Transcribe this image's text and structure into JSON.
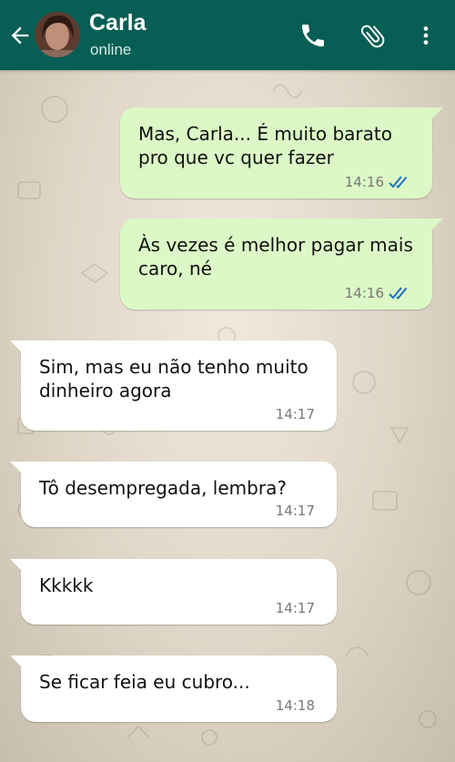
{
  "header": {
    "contact_name": "Carla",
    "status": "online",
    "color": "#075e54"
  },
  "icons": {
    "back": "arrow-left-icon",
    "phone": "phone-icon",
    "attach": "paperclip-icon",
    "menu": "more-vertical-icon",
    "read": "double-check-icon"
  },
  "messages": [
    {
      "direction": "out",
      "text": "Mas, Carla... É muito barato\npro que vc quer fazer",
      "time": "14:16",
      "read": true
    },
    {
      "direction": "out",
      "text": "Às vezes é melhor pagar mais\ncaro, né",
      "time": "14:16",
      "read": true
    },
    {
      "direction": "in",
      "text": "Sim, mas eu não tenho muito\ndinheiro agora",
      "time": "14:17"
    },
    {
      "direction": "in",
      "text": "Tô desempregada, lembra?",
      "time": "14:17"
    },
    {
      "direction": "in",
      "text": "Kkkkk",
      "time": "14:17"
    },
    {
      "direction": "in",
      "text": "Se ficar feia eu cubro...",
      "time": "14:18"
    }
  ],
  "colors": {
    "outgoing_bubble": "#dcf8c6",
    "incoming_bubble": "#ffffff",
    "read_ticks": "#4fc3f7"
  }
}
